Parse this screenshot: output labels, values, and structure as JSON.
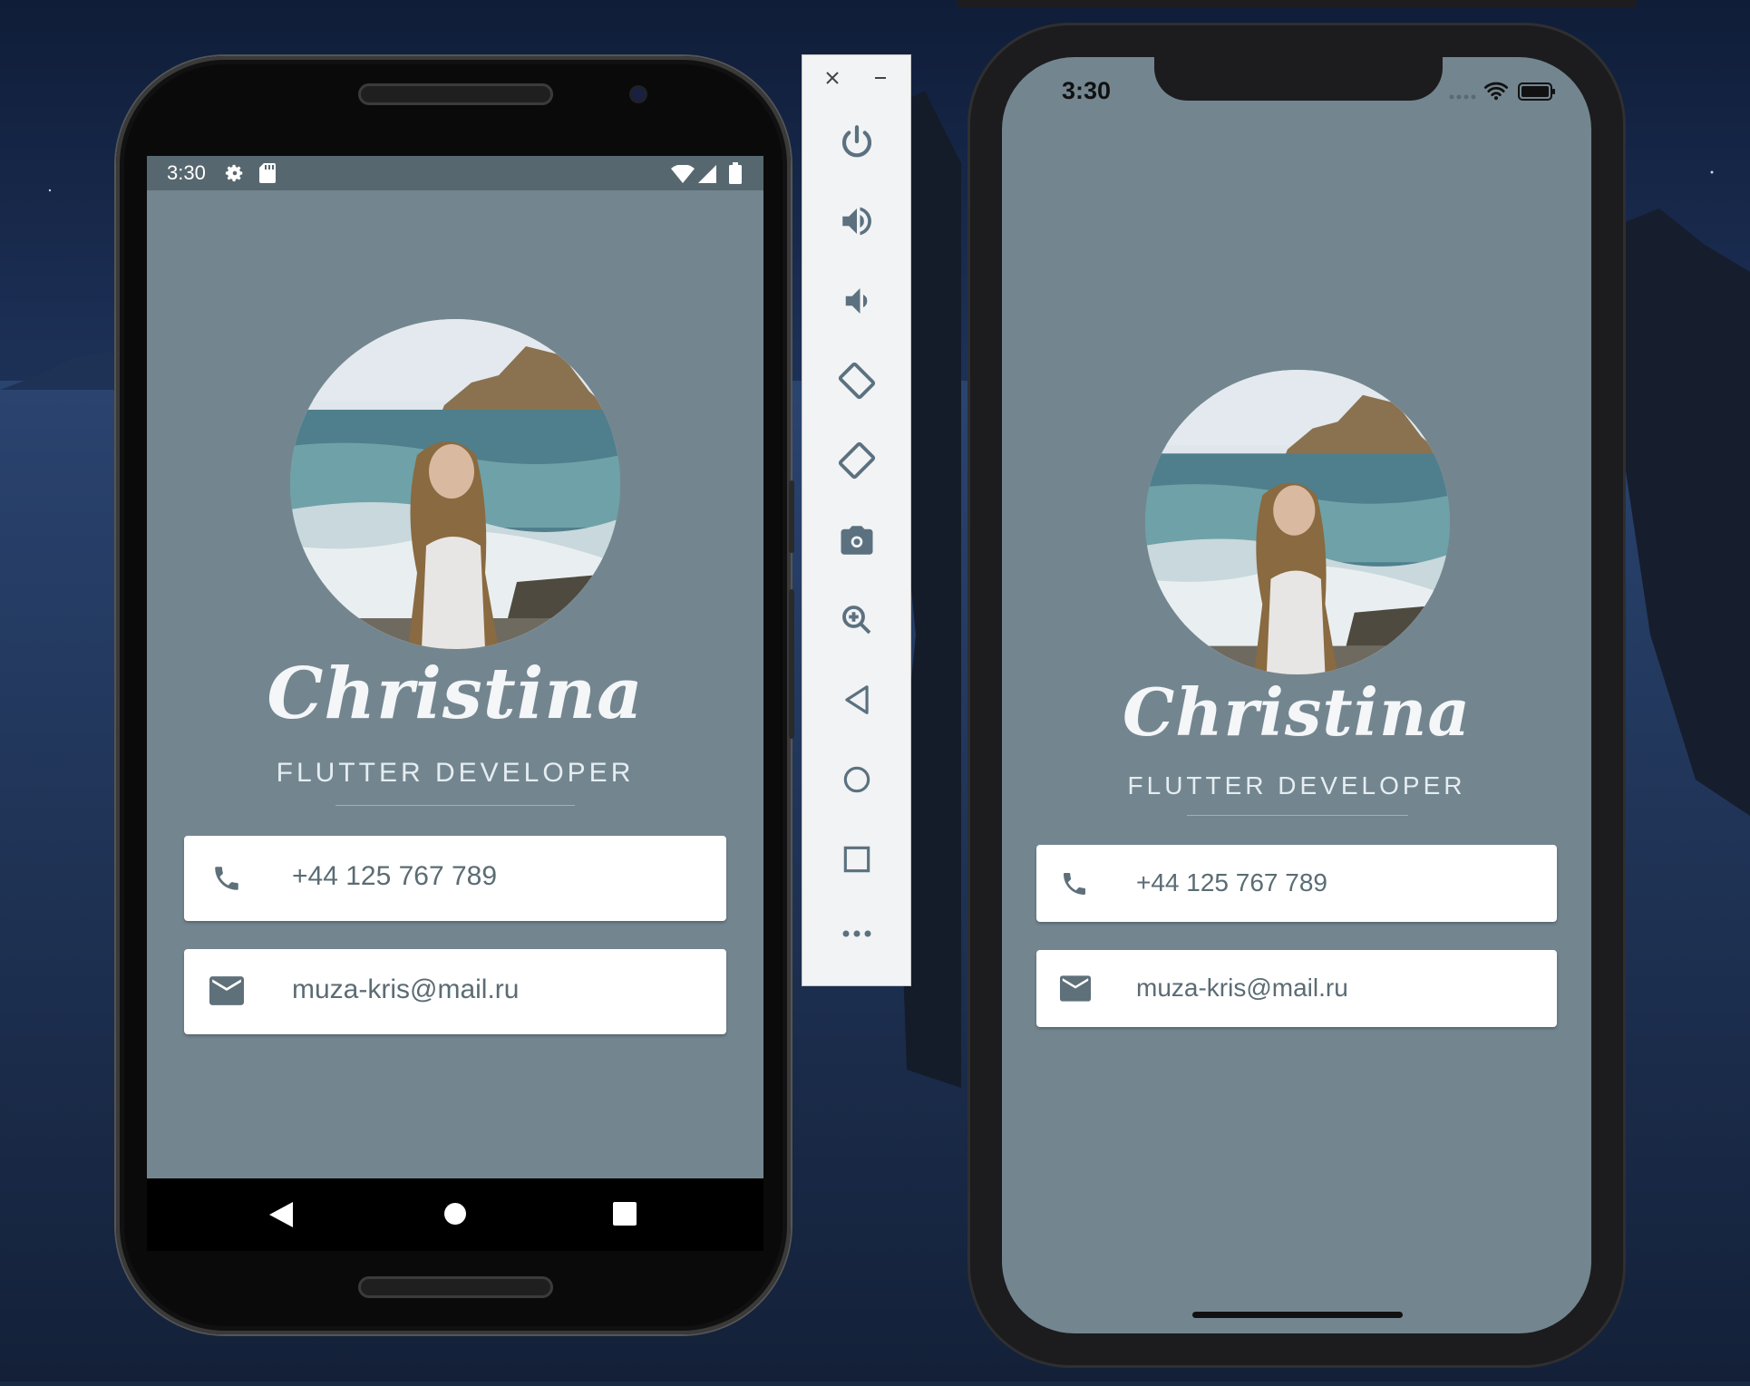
{
  "android": {
    "status_time": "3:30",
    "name": "Christina",
    "title": "FLUTTER DEVELOPER",
    "phone": "+44 125 767 789",
    "email": "muza-kris@mail.ru"
  },
  "iphone": {
    "status_time": "3:30",
    "name": "Christina",
    "title": "FLUTTER DEVELOPER",
    "phone": "+44 125 767 789",
    "email": "muza-kris@mail.ru"
  },
  "emulator_toolbar": {
    "buttons": [
      "close-icon",
      "minimize-icon",
      "power-icon",
      "volume-up-icon",
      "volume-down-icon",
      "rotate-left-icon",
      "rotate-right-icon",
      "camera-icon",
      "zoom-icon",
      "back-icon",
      "home-icon",
      "overview-icon",
      "more-icon"
    ]
  },
  "colors": {
    "screen_background": "#738690",
    "android_status_bar": "#56676f",
    "card_background": "#ffffff",
    "card_text": "#5b6c74",
    "name_text": "#f4f6f8"
  }
}
